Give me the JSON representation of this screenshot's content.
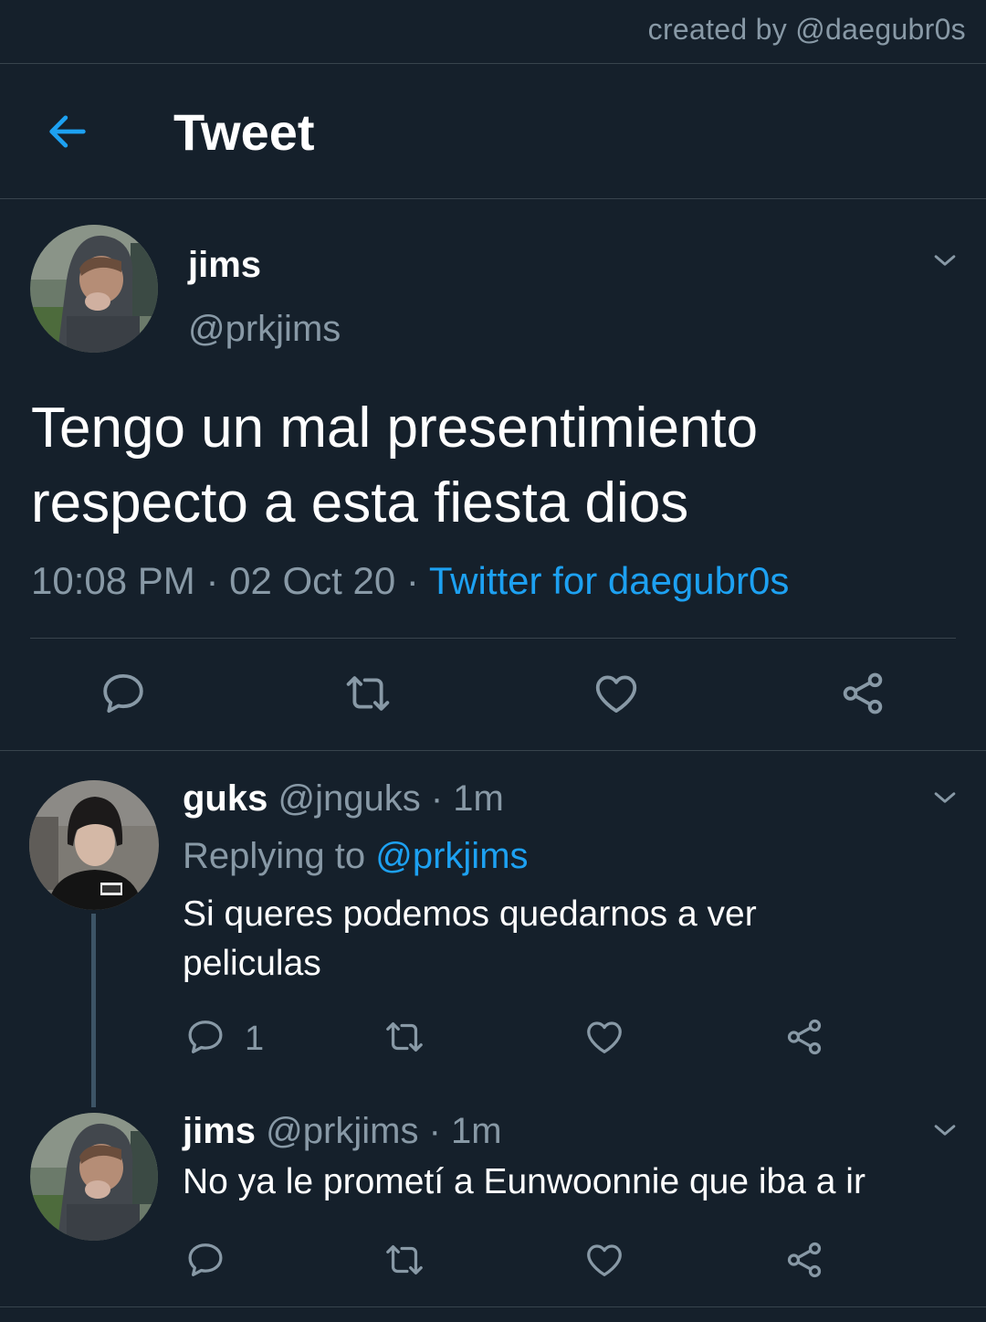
{
  "watermark": "created by @daegubr0s",
  "header": {
    "title": "Tweet",
    "back_icon": "arrow-left-icon"
  },
  "main_tweet": {
    "name": "jims",
    "handle": "@prkjims",
    "text_line1": "Tengo un mal presentimiento",
    "text_line2": "respecto a esta fiesta dios",
    "time": "10:08 PM",
    "date": "02 Oct 20",
    "source": "Twitter for daegubr0s",
    "sep": "·"
  },
  "replies": [
    {
      "name": "guks",
      "handle": "@jnguks",
      "time": "1m",
      "replying_prefix": "Replying to",
      "replying_to": "@prkjims",
      "text_line1": "Si queres podemos quedarnos a ver",
      "text_line2": "peliculas",
      "reply_count": "1"
    },
    {
      "name": "jims",
      "handle": "@prkjims",
      "time": "1m",
      "text": "No ya le prometí a Eunwoonnie que iba a ir"
    }
  ],
  "colors": {
    "background": "#15202b",
    "accent": "#1da1f2",
    "muted": "#8899a6",
    "divider": "#38444d"
  },
  "icons": [
    "arrow-left-icon",
    "chevron-down-icon",
    "reply-icon",
    "retweet-icon",
    "like-icon",
    "share-icon"
  ]
}
